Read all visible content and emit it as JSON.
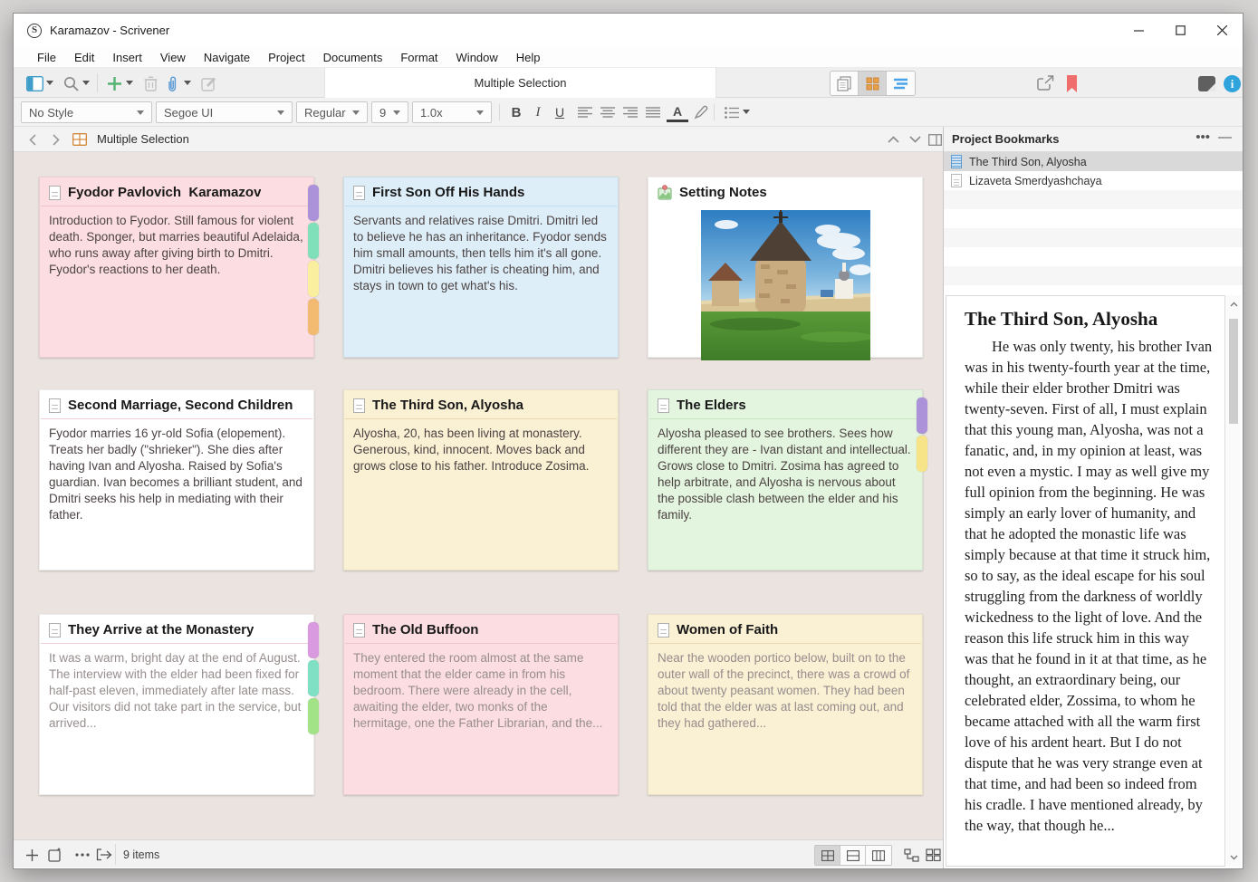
{
  "window": {
    "title": "Karamazov - Scrivener"
  },
  "menu": {
    "items": [
      "File",
      "Edit",
      "Insert",
      "View",
      "Navigate",
      "Project",
      "Documents",
      "Format",
      "Window",
      "Help"
    ]
  },
  "toolbar": {
    "title_field": "Multiple Selection"
  },
  "format_bar": {
    "style": "No Style",
    "font": "Segoe UI",
    "variant": "Regular",
    "size": "9",
    "line_spacing": "1.0x"
  },
  "editor": {
    "header_title": "Multiple Selection"
  },
  "icons": {
    "binder": "sidebar-panel",
    "search": "magnifier",
    "add": "green-plus",
    "trash": "trash-can",
    "bookmark": "red-ribbon",
    "info": "blue-info-circle",
    "corkboard_view": "orange-grid",
    "outline_view": "blue-lines",
    "scrivenings_view": "stacked-pages"
  },
  "colors": {
    "accent_orange": "#e0923e",
    "accent_blue": "#4aa3e8",
    "bookmark_red": "#f06d6d",
    "corkboard_bg": "#ebe3e0",
    "info_blue": "#2fa3dc",
    "add_green": "#53b373"
  },
  "corkboard": {
    "cards": [
      {
        "title": "Fyodor Pavlovich  Karamazov",
        "body": "Introduction to Fyodor. Still famous for violent death. Sponger, but marries beautiful Adelaida, who runs away after giving birth to Dmitri. Fyodor's reactions to her death.",
        "bg": "#fcdee2",
        "divider": "#eec3ca",
        "chips": [
          "#ab92d9",
          "#7fe0ba",
          "#f9ef9e",
          "#f3bb72"
        ]
      },
      {
        "title": "First Son Off His Hands",
        "body": "Servants and relatives raise Dmitri. Dmitri led to believe he has an inheritance. Fyodor sends him small amounts, then tells him it's all gone. Dmitri believes his father is cheating him, and stays in town to get what's his.",
        "bg": "#ddeef8",
        "divider": "#c4ddee",
        "chips": []
      },
      {
        "title": "Setting Notes",
        "body": "",
        "bg": "#ffffff",
        "divider": "transparent",
        "chips": []
      },
      {
        "title": "Second Marriage, Second Children",
        "body": "Fyodor marries 16 yr-old Sofia (elopement). Treats her badly (\"shrieker\"). She dies after having Ivan and Alyosha. Raised by Sofia's guardian. Ivan becomes a brilliant student, and Dmitri seeks his help in mediating with their father.",
        "bg": "#ffffff",
        "divider": "#f0cdd2",
        "chips": []
      },
      {
        "title": "The Third Son, Alyosha",
        "body": "Alyosha, 20, has been living at monastery. Generous, kind, innocent. Moves back and grows close to his father. Introduce Zosima.",
        "bg": "#faf0d4",
        "divider": "#e9d8ab",
        "chips": []
      },
      {
        "title": "The Elders",
        "body": "Alyosha pleased to see brothers. Sees how different they are - Ivan distant and intellectual. Grows close to Dmitri. Zosima has agreed to help arbitrate, and Alyosha is nervous about the possible clash between the elder and his family.",
        "bg": "#e3f5df",
        "divider": "#c8e6c2",
        "chips": [
          "#ab92d9",
          "#f7e388"
        ]
      },
      {
        "title": "They Arrive at the Monastery",
        "body": "It was a warm, bright day at the end of August. The interview with the elder had been fixed for half-past eleven, immediately after late mass. Our visitors did not take part in the service, but arrived...",
        "bg": "#ffffff",
        "divider": "#f0cdd2",
        "chips": [
          "#d99ae0",
          "#7fe0c4",
          "#a3e388"
        ]
      },
      {
        "title": "The Old Buffoon",
        "body": "They entered the room almost at the same moment that the elder came in from his bedroom. There were already in the cell, awaiting the elder, two monks of the hermitage, one the Father Librarian, and the...",
        "bg": "#fcdee2",
        "divider": "#eec3ca",
        "chips": []
      },
      {
        "title": "Women of Faith",
        "body": "Near the wooden portico below, built on to the outer wall of the precinct, there was a crowd of about twenty peasant women. They had been told that the elder was at last coming out, and they had gathered...",
        "bg": "#faf0d4",
        "divider": "#e9d8ab",
        "chips": []
      }
    ]
  },
  "bookmarks": {
    "title": "Project Bookmarks",
    "items": [
      {
        "label": "The Third Son, Alyosha"
      },
      {
        "label": "Lizaveta Smerdyashchaya"
      }
    ]
  },
  "preview": {
    "title": "The Third Son, Alyosha",
    "text": "He was only twenty, his brother Ivan was in his twenty-fourth year at the time, while their elder brother Dmitri was twenty-seven. First of all, I must explain that this young man, Alyosha, was not a fanatic, and, in my opinion at least, was not even a mystic. I may as well give my full opinion from the beginning. He was simply an early lover of humanity, and that he adopted the monastic life was simply because at that time it struck him, so to say, as the ideal escape for his soul struggling from the darkness of worldly wickedness to the light of love. And the reason this life struck him in this way was that he found in it at that time, as he thought, an extraordinary being, our celebrated elder, Zossima, to whom he became attached with all the warm first love of his ardent heart. But I do not dispute that he was very strange even at that time, and had been so indeed from his cradle. I have mentioned already, by the way, that though he..."
  },
  "status": {
    "count": "9 items"
  }
}
